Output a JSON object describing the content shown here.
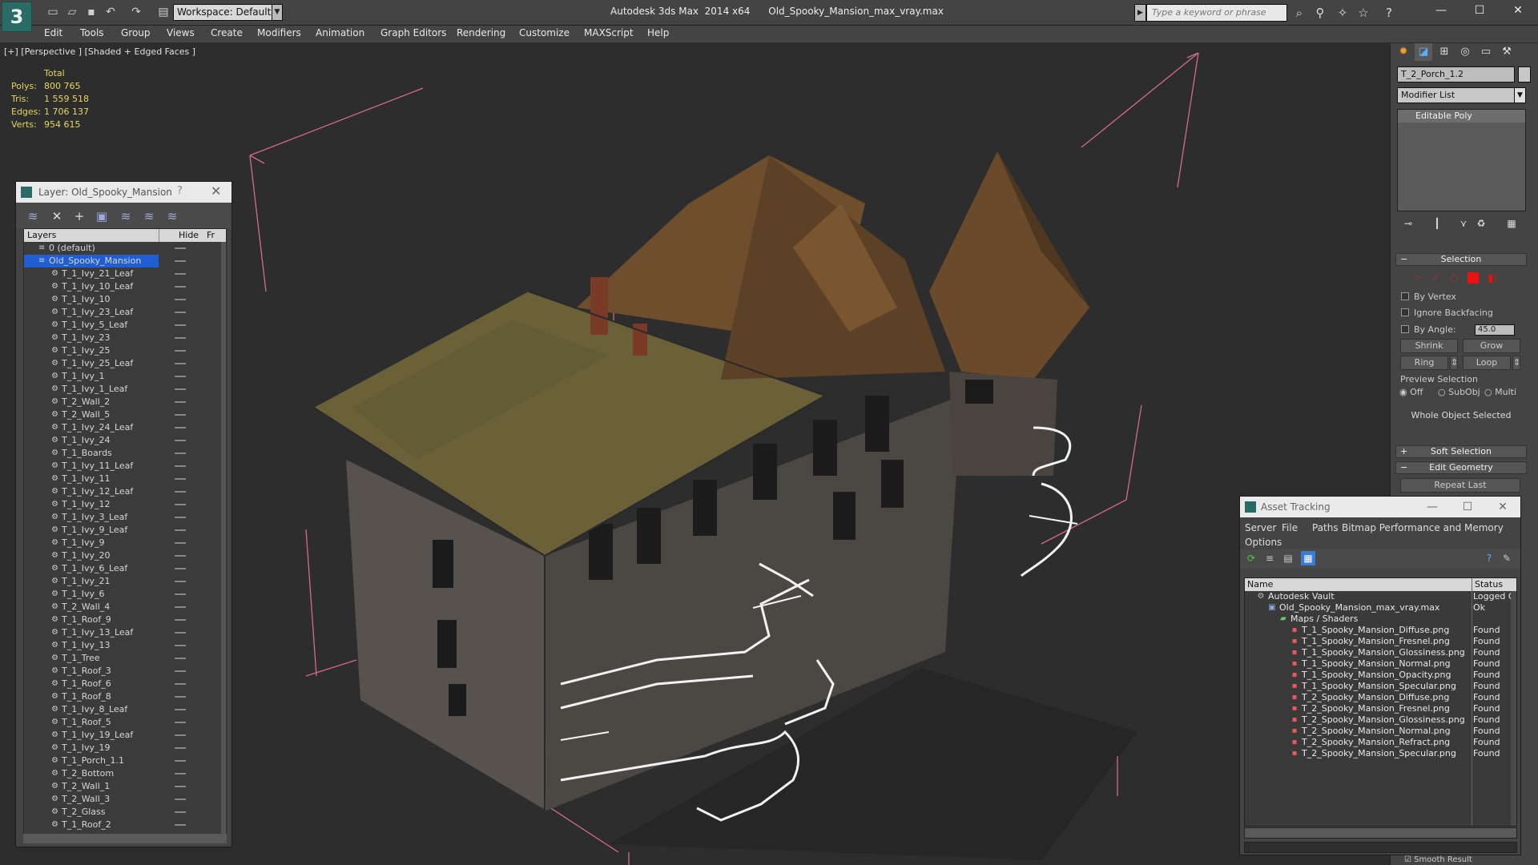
{
  "titlebar": {
    "logo": "3",
    "workspace": "Workspace: Default",
    "app_title": "Autodesk 3ds Max  2014 x64      Old_Spooky_Mansion_max_vray.max",
    "search_placeholder": "Type a keyword or phrase"
  },
  "menu": [
    "Edit",
    "Tools",
    "Group",
    "Views",
    "Create",
    "Modifiers",
    "Animation",
    "Graph Editors",
    "Rendering",
    "Customize",
    "MAXScript",
    "Help"
  ],
  "viewport": {
    "label": "[+] [Perspective ] [Shaded + Edged Faces ]",
    "stats": {
      "total_label": "Total",
      "rows": [
        {
          "label": "Polys:",
          "value": "800 765"
        },
        {
          "label": "Tris:",
          "value": "1 559 518"
        },
        {
          "label": "Edges:",
          "value": "1 706 137"
        },
        {
          "label": "Verts:",
          "value": "954 615"
        }
      ]
    }
  },
  "layer_explorer": {
    "title": "Layer: Old_Spooky_Mansion",
    "help": "?",
    "col_layers": "Layers",
    "col_hide": "Hide",
    "col_fr": "Fr",
    "rows": [
      "0 (default)",
      "Old_Spooky_Mansion",
      "T_1_Ivy_21_Leaf",
      "T_1_Ivy_10_Leaf",
      "T_1_Ivy_10",
      "T_1_Ivy_23_Leaf",
      "T_1_Ivy_5_Leaf",
      "T_1_Ivy_23",
      "T_1_Ivy_25",
      "T_1_Ivy_25_Leaf",
      "T_1_Ivy_1",
      "T_1_Ivy_1_Leaf",
      "T_2_Wall_2",
      "T_2_Wall_5",
      "T_1_Ivy_24_Leaf",
      "T_1_Ivy_24",
      "T_1_Boards",
      "T_1_Ivy_11_Leaf",
      "T_1_Ivy_11",
      "T_1_Ivy_12_Leaf",
      "T_1_Ivy_12",
      "T_1_Ivy_3_Leaf",
      "T_1_Ivy_9_Leaf",
      "T_1_Ivy_9",
      "T_1_Ivy_20",
      "T_1_Ivy_6_Leaf",
      "T_1_Ivy_21",
      "T_1_Ivy_6",
      "T_2_Wall_4",
      "T_1_Roof_9",
      "T_1_Ivy_13_Leaf",
      "T_1_Ivy_13",
      "T_1_Tree",
      "T_1_Roof_3",
      "T_1_Roof_6",
      "T_1_Roof_8",
      "T_1_Ivy_8_Leaf",
      "T_1_Roof_5",
      "T_1_Ivy_19_Leaf",
      "T_1_Ivy_19",
      "T_1_Porch_1.1",
      "T_2_Bottom",
      "T_2_Wall_1",
      "T_2_Wall_3",
      "T_2_Glass",
      "T_1_Roof_2"
    ]
  },
  "command_panel": {
    "object_name": "T_2_Porch_1.2",
    "modifier_list": "Modifier List",
    "stack_item": "Editable Poly",
    "selection_title": "Selection",
    "by_vertex": "By Vertex",
    "ignore_backfacing": "Ignore Backfacing",
    "by_angle": "By Angle:",
    "angle_value": "45.0",
    "shrink": "Shrink",
    "grow": "Grow",
    "ring": "Ring",
    "loop": "Loop",
    "preview_selection": "Preview Selection",
    "off": "Off",
    "subobj": "SubObj",
    "multi": "Multi",
    "whole_object": "Whole Object Selected",
    "soft_selection": "Soft Selection",
    "edit_geometry": "Edit Geometry",
    "repeat_last": "Repeat Last",
    "smooth_result": "Smooth Result"
  },
  "asset_tracking": {
    "title": "Asset Tracking",
    "menu": [
      "Server",
      "File",
      "Paths",
      "Bitmap Performance and Memory",
      "Options"
    ],
    "col_name": "Name",
    "col_status": "Status",
    "rows": [
      {
        "name": "Autodesk Vault",
        "status": "Logged O"
      },
      {
        "name": "Old_Spooky_Mansion_max_vray.max",
        "status": "Ok"
      },
      {
        "name": "Maps / Shaders",
        "status": ""
      },
      {
        "name": "T_1_Spooky_Mansion_Diffuse.png",
        "status": "Found"
      },
      {
        "name": "T_1_Spooky_Mansion_Fresnel.png",
        "status": "Found"
      },
      {
        "name": "T_1_Spooky_Mansion_Glossiness.png",
        "status": "Found"
      },
      {
        "name": "T_1_Spooky_Mansion_Normal.png",
        "status": "Found"
      },
      {
        "name": "T_1_Spooky_Mansion_Opacity.png",
        "status": "Found"
      },
      {
        "name": "T_1_Spooky_Mansion_Specular.png",
        "status": "Found"
      },
      {
        "name": "T_2_Spooky_Mansion_Diffuse.png",
        "status": "Found"
      },
      {
        "name": "T_2_Spooky_Mansion_Fresnel.png",
        "status": "Found"
      },
      {
        "name": "T_2_Spooky_Mansion_Glossiness.png",
        "status": "Found"
      },
      {
        "name": "T_2_Spooky_Mansion_Normal.png",
        "status": "Found"
      },
      {
        "name": "T_2_Spooky_Mansion_Refract.png",
        "status": "Found"
      },
      {
        "name": "T_2_Spooky_Mansion_Specular.png",
        "status": "Found"
      }
    ]
  },
  "colors": {
    "accent": "#2b6b66",
    "selection_blue": "#1f5fd1",
    "stats_yellow": "#e8d55a",
    "bbox_pink": "#d46a8c"
  }
}
